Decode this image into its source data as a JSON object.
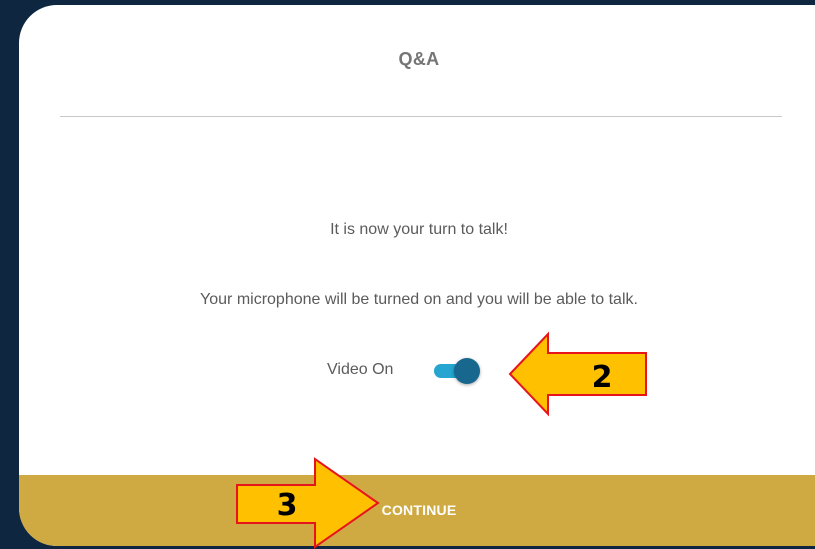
{
  "modal": {
    "title": "Q&A",
    "message_1": "It is now your turn to talk!",
    "message_2": "Your microphone will be turned on and you will be able to talk.",
    "video_toggle": {
      "label": "Video On",
      "state": "on"
    },
    "continue_label": "CONTINUE"
  },
  "annotations": {
    "arrow_2_label": "2",
    "arrow_3_label": "3"
  },
  "colors": {
    "page_background": "#0e2640",
    "modal_background": "#ffffff",
    "footer_background": "#cfaa43",
    "toggle_track": "#25a5cf",
    "toggle_knob": "#17678f",
    "annotation_fill": "#ffc000",
    "annotation_stroke": "#e8141b"
  },
  "icons": {
    "annotation_arrow_2": "left-arrow-icon",
    "annotation_arrow_3": "right-arrow-icon"
  }
}
